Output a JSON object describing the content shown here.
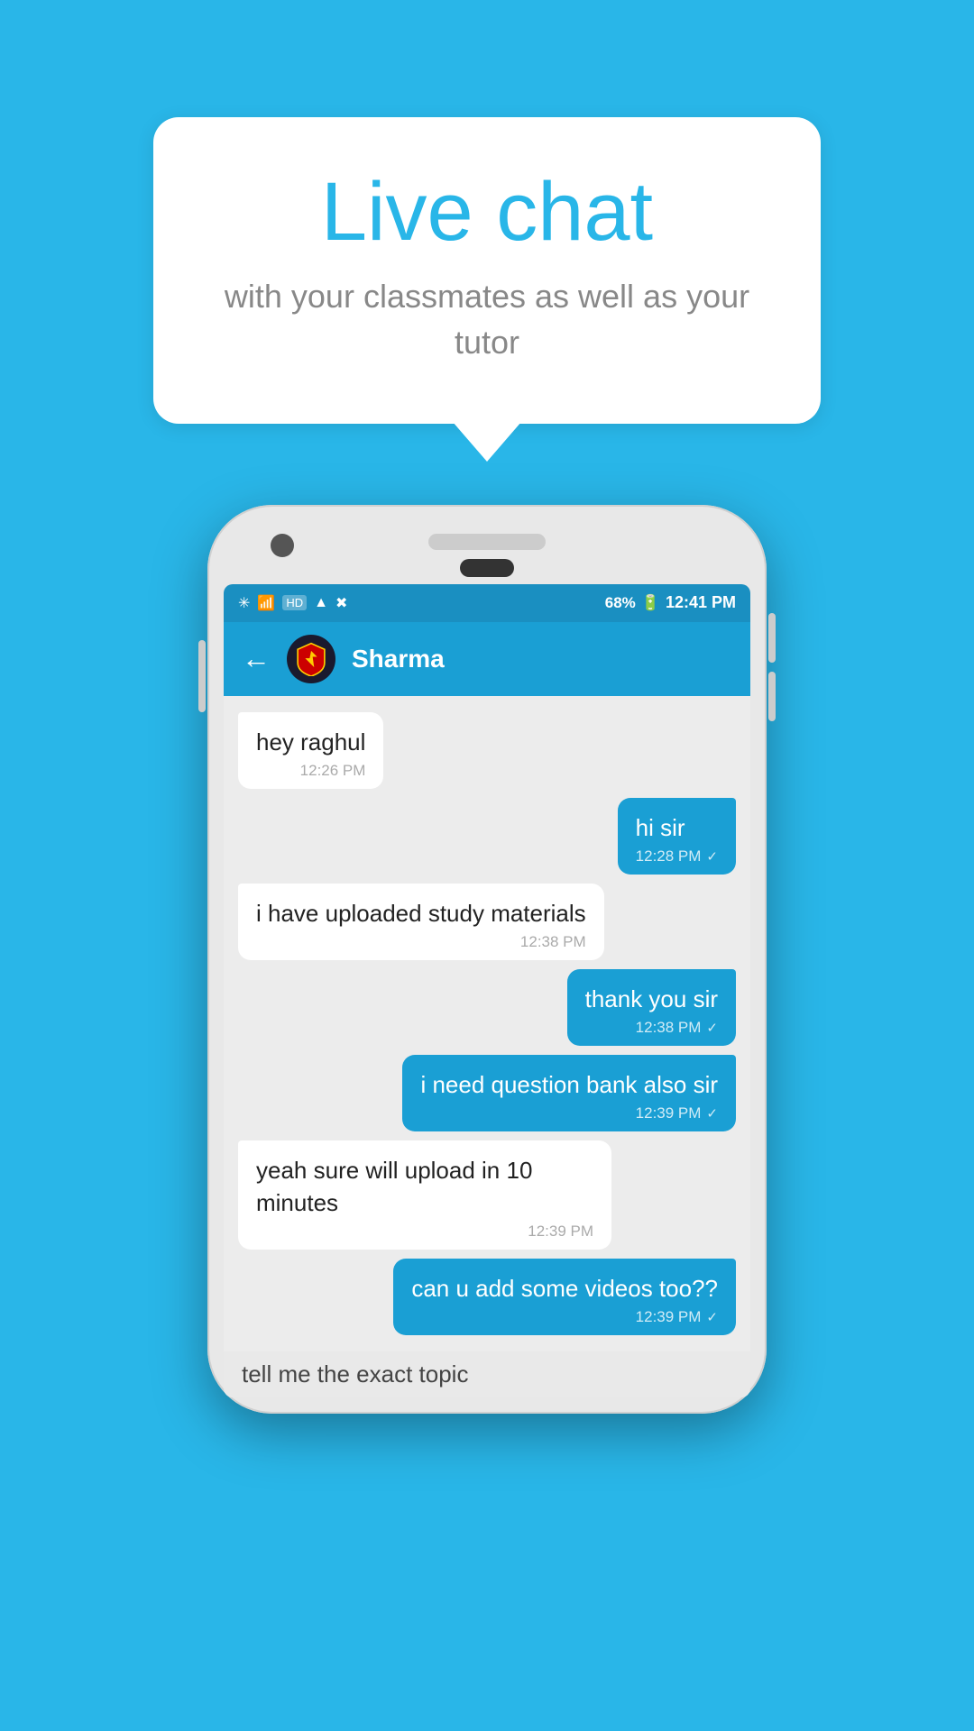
{
  "background_color": "#29b6e8",
  "bubble": {
    "title": "Live chat",
    "subtitle": "with your classmates as well as your tutor"
  },
  "phone": {
    "status_bar": {
      "time": "12:41 PM",
      "battery": "68%",
      "signal_icons": "🔷📶📡"
    },
    "header": {
      "contact_name": "Sharma",
      "back_label": "←"
    },
    "messages": [
      {
        "id": 1,
        "type": "received",
        "text": "hey raghul",
        "time": "12:26 PM",
        "tick": ""
      },
      {
        "id": 2,
        "type": "sent",
        "text": "hi sir",
        "time": "12:28 PM",
        "tick": "✓"
      },
      {
        "id": 3,
        "type": "received",
        "text": "i have uploaded study materials",
        "time": "12:38 PM",
        "tick": ""
      },
      {
        "id": 4,
        "type": "sent",
        "text": "thank you sir",
        "time": "12:38 PM",
        "tick": "✓"
      },
      {
        "id": 5,
        "type": "sent",
        "text": "i need question bank also sir",
        "time": "12:39 PM",
        "tick": "✓"
      },
      {
        "id": 6,
        "type": "received",
        "text": "yeah sure will upload in 10 minutes",
        "time": "12:39 PM",
        "tick": ""
      },
      {
        "id": 7,
        "type": "sent",
        "text": "can u add some videos too??",
        "time": "12:39 PM",
        "tick": "✓"
      }
    ],
    "cutoff_text": "tell me the exact topic"
  }
}
